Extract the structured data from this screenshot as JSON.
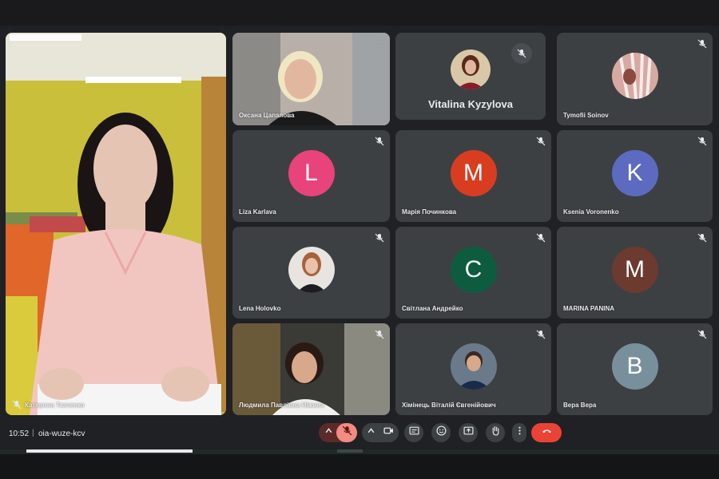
{
  "colors": {
    "background": "#202124",
    "tile": "#3c4043",
    "end_call": "#ea4335",
    "mic_muted": "#f28b82"
  },
  "main_speaker": {
    "name": "Катерина Ткаченко"
  },
  "tiles": [
    {
      "name": "Оксана Цапапова",
      "type": "video",
      "icon": "camera-feed"
    },
    {
      "name": "Vitalina Kyzylova",
      "type": "photo-avatar",
      "muted": true
    },
    {
      "name": "Tymofii Soinov",
      "type": "photo-avatar",
      "muted": true
    },
    {
      "name": "Liza Karlava",
      "type": "letter",
      "letter": "L",
      "color": "#e8437a",
      "muted": true
    },
    {
      "name": "Марія Починкова",
      "type": "letter",
      "letter": "M",
      "color": "#d93d20",
      "muted": true
    },
    {
      "name": "Ksenia Voronenko",
      "type": "letter",
      "letter": "K",
      "color": "#5c6bc0",
      "muted": true
    },
    {
      "name": "Lena Holovko",
      "type": "photo-avatar",
      "muted": true
    },
    {
      "name": "Світлана Андрейко",
      "type": "letter",
      "letter": "C",
      "color": "#0d5c3f",
      "muted": true
    },
    {
      "name": "MARINA PANINA",
      "type": "letter",
      "letter": "M",
      "color": "#6d3a2f",
      "muted": true
    },
    {
      "name": "Людмила Павлівна Ніжина",
      "type": "video",
      "muted": true
    },
    {
      "name": "Хімінець Віталій Євгенійович",
      "type": "photo-avatar",
      "muted": true
    },
    {
      "name": "Вера Вера",
      "type": "letter",
      "letter": "B",
      "color": "#78909c",
      "muted": true
    }
  ],
  "bottom_bar": {
    "time": "10:52",
    "separator": "|",
    "meeting_code": "oia-wuze-kcv"
  },
  "controls": [
    {
      "name": "audio-options",
      "icon": "chevron-up-icon"
    },
    {
      "name": "microphone",
      "icon": "mic-off-icon"
    },
    {
      "name": "video-options",
      "icon": "chevron-up-icon"
    },
    {
      "name": "camera",
      "icon": "camera-icon"
    },
    {
      "name": "captions",
      "icon": "captions-icon"
    },
    {
      "name": "reactions",
      "icon": "emoji-icon"
    },
    {
      "name": "present",
      "icon": "present-icon"
    },
    {
      "name": "raise-hand",
      "icon": "hand-icon"
    },
    {
      "name": "more-options",
      "icon": "more-vert-icon"
    },
    {
      "name": "leave-call",
      "icon": "phone-hangup-icon"
    }
  ]
}
